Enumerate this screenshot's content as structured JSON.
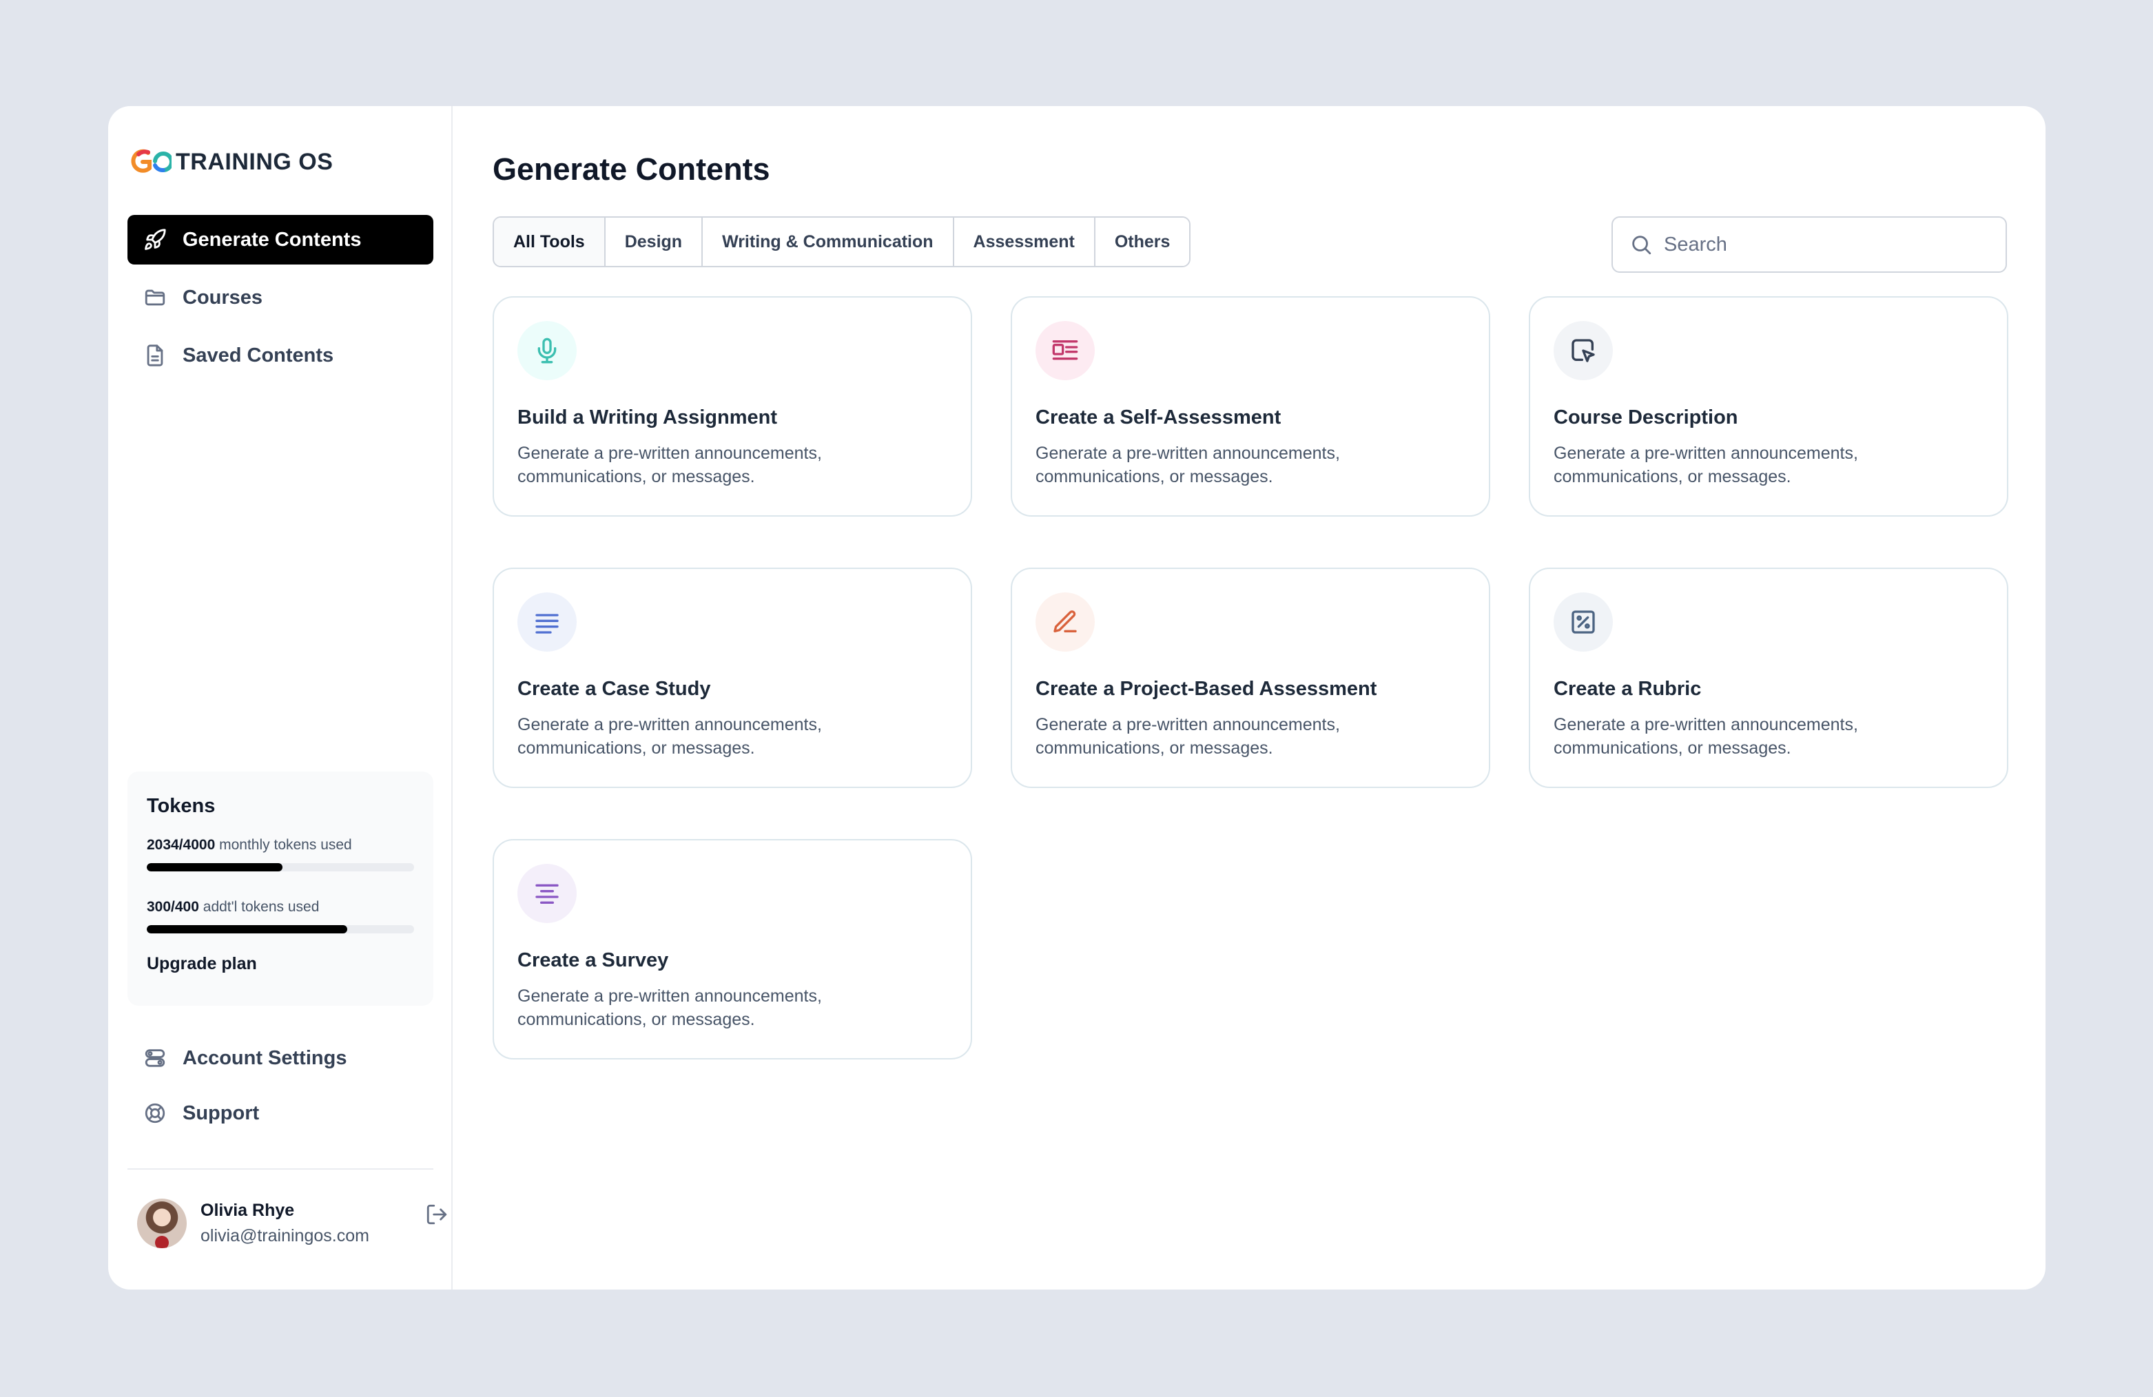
{
  "brand": {
    "name": "TRAINING OS"
  },
  "sidebar": {
    "items": [
      {
        "label": "Generate Contents",
        "icon": "rocket-icon",
        "active": true
      },
      {
        "label": "Courses",
        "icon": "folder-icon",
        "active": false
      },
      {
        "label": "Saved Contents",
        "icon": "document-icon",
        "active": false
      }
    ],
    "tokens": {
      "title": "Tokens",
      "monthly": {
        "count": "2034/4000",
        "label": "monthly tokens used",
        "fraction": 0.5085
      },
      "additional": {
        "count": "300/400",
        "label": "addt'l tokens used",
        "fraction": 0.75
      },
      "upgrade_label": "Upgrade plan"
    },
    "bottom_items": [
      {
        "label": "Account Settings",
        "icon": "settings-toggle-icon"
      },
      {
        "label": "Support",
        "icon": "lifebuoy-icon"
      }
    ],
    "user": {
      "name": "Olivia Rhye",
      "email": "olivia@trainingos.com"
    }
  },
  "main": {
    "title": "Generate Contents",
    "tabs": [
      {
        "label": "All Tools",
        "active": true
      },
      {
        "label": "Design",
        "active": false
      },
      {
        "label": "Writing & Communication",
        "active": false
      },
      {
        "label": "Assessment",
        "active": false
      },
      {
        "label": "Others",
        "active": false
      }
    ],
    "search": {
      "placeholder": "Search",
      "value": ""
    },
    "cards": [
      {
        "title": "Build a Writing Assignment",
        "desc": "Generate a pre-written announcements, communications, or messages.",
        "icon": "microphone-icon",
        "bg": "#ecfdfb",
        "fg": "#3cbfb0"
      },
      {
        "title": "Create a Self-Assessment",
        "desc": "Generate a pre-written announcements, communications, or messages.",
        "icon": "layout-list-icon",
        "bg": "#fdebf2",
        "fg": "#c2386b"
      },
      {
        "title": "Course Description",
        "desc": "Generate a pre-written announcements, communications, or messages.",
        "icon": "cursor-box-icon",
        "bg": "#f2f4f7",
        "fg": "#344054"
      },
      {
        "title": "Create a Case Study",
        "desc": "Generate a pre-written announcements, communications, or messages.",
        "icon": "lines-icon",
        "bg": "#eef2fb",
        "fg": "#4f6fd1"
      },
      {
        "title": "Create a Project-Based Assessment",
        "desc": "Generate a pre-written announcements, communications, or messages.",
        "icon": "pencil-icon",
        "bg": "#fdf2ee",
        "fg": "#d9623c"
      },
      {
        "title": "Create a Rubric",
        "desc": "Generate a pre-written announcements, communications, or messages.",
        "icon": "percent-box-icon",
        "bg": "#f0f3f7",
        "fg": "#4b6382"
      },
      {
        "title": "Create a Survey",
        "desc": "Generate a pre-written announcements, communications, or messages.",
        "icon": "align-center-icon",
        "bg": "#f4effa",
        "fg": "#8a57c4"
      }
    ]
  }
}
